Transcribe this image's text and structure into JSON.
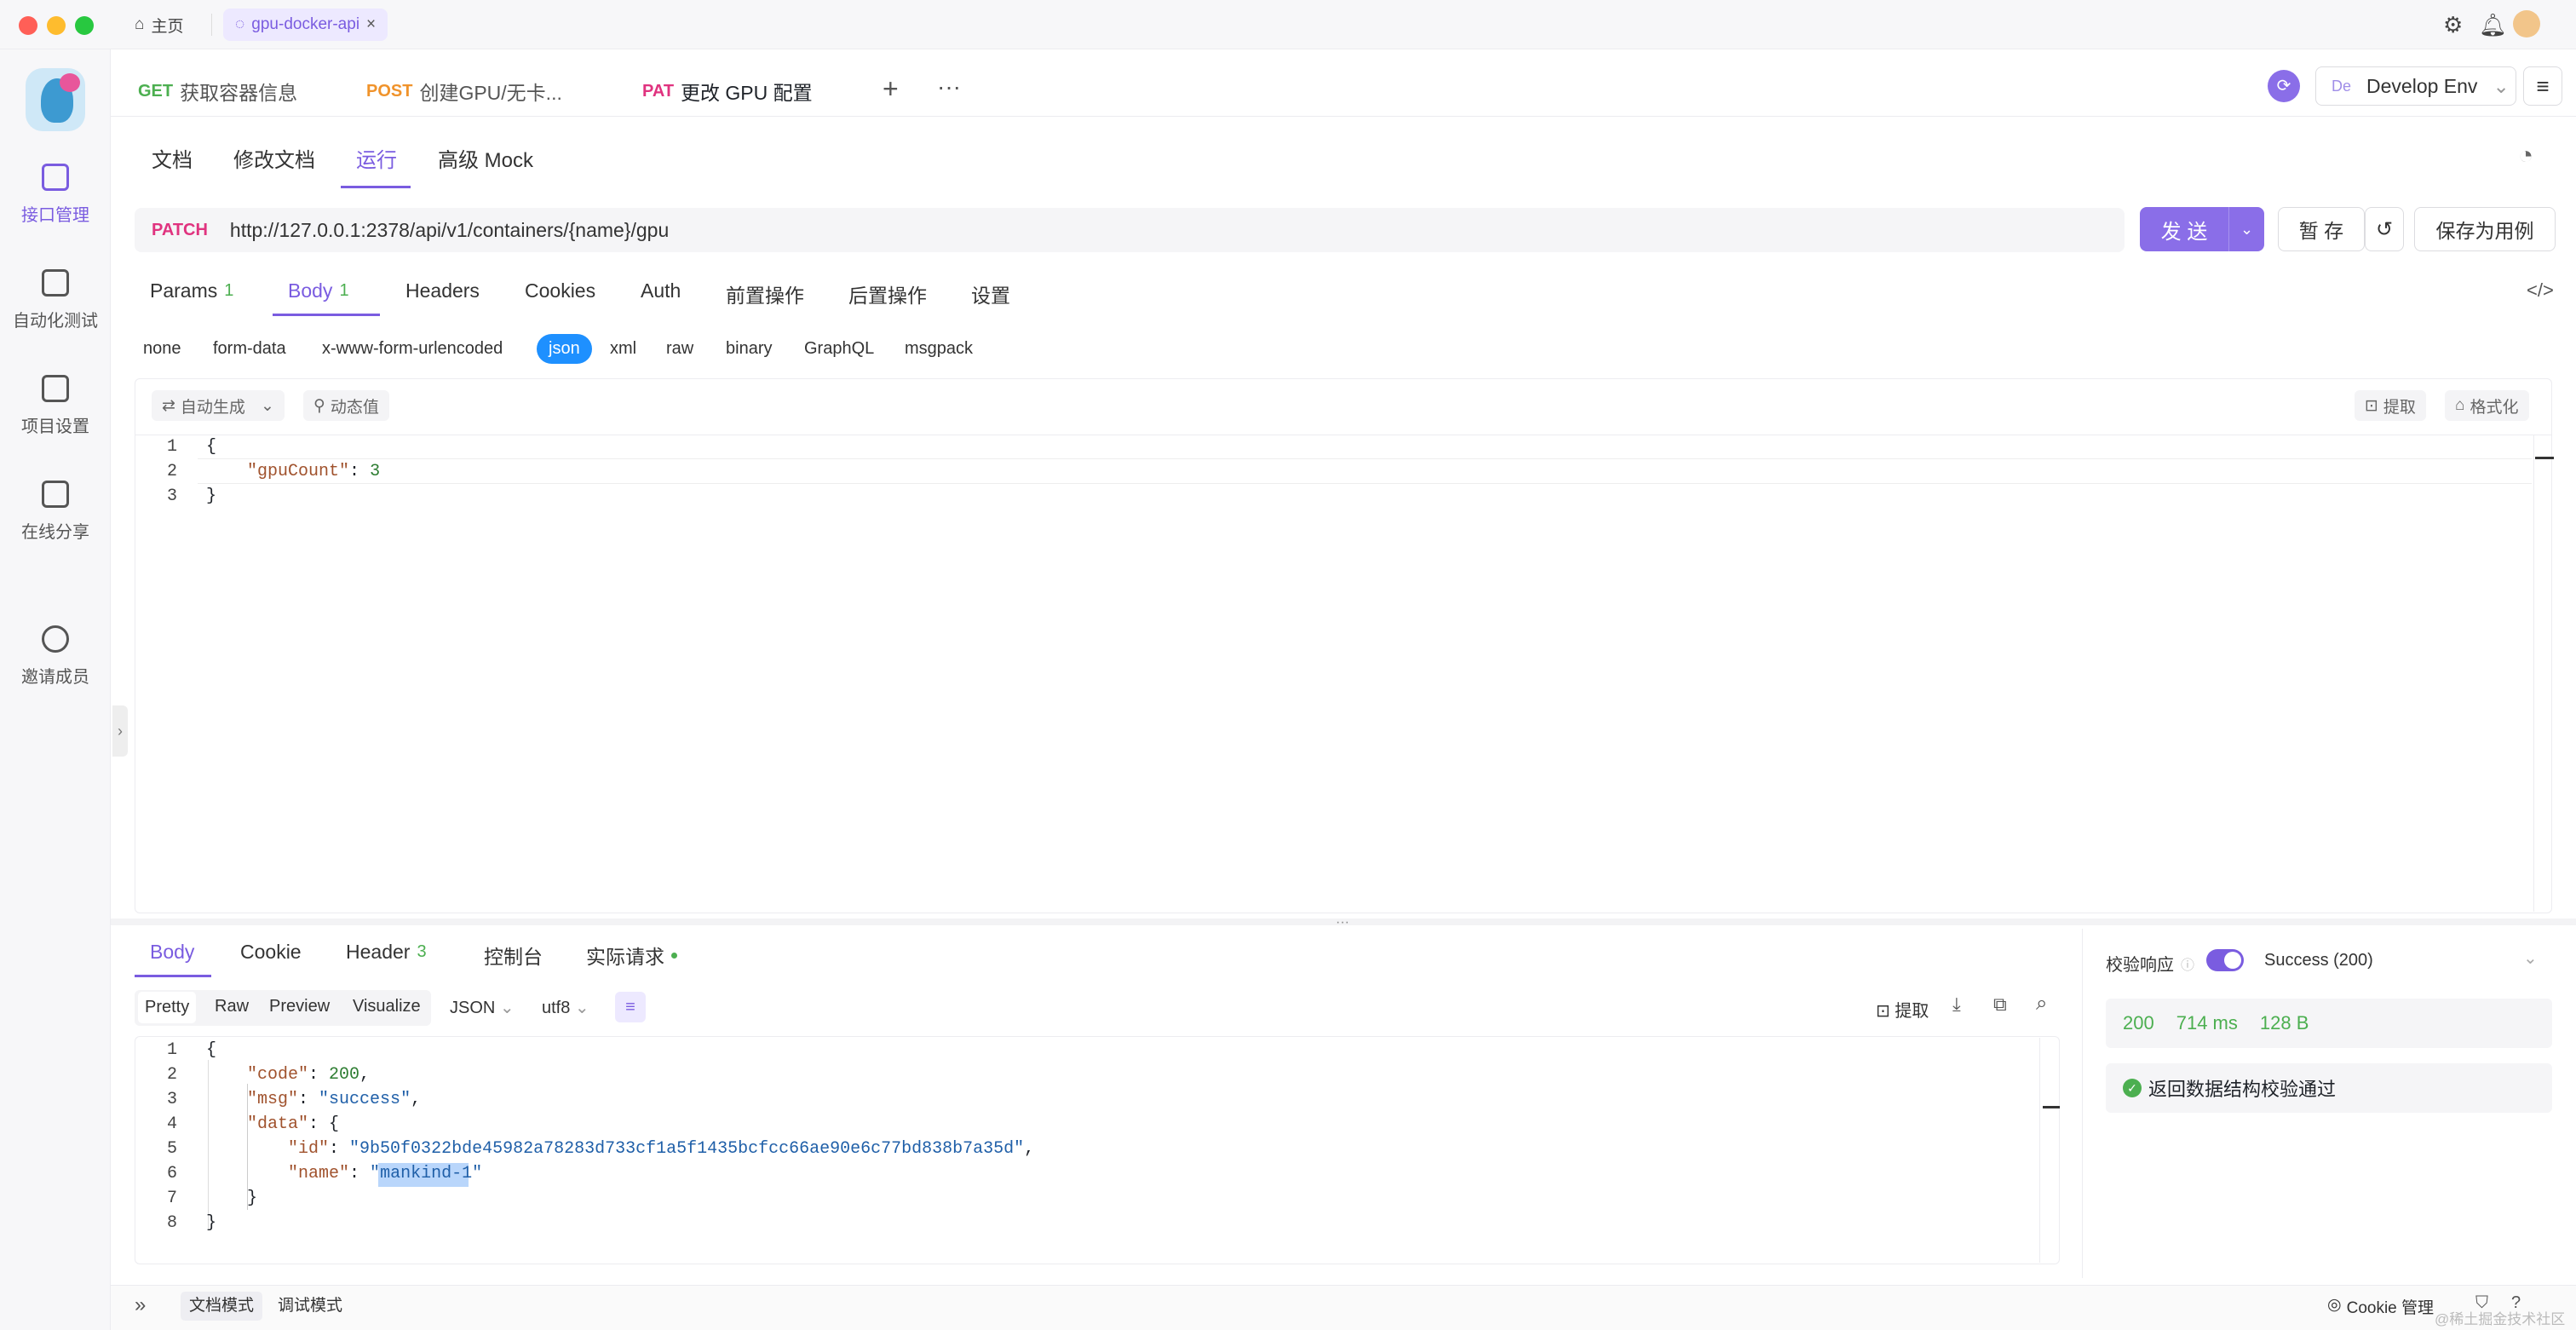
{
  "titlebar": {
    "home_label": "主页",
    "project_tab": "gpu-docker-api"
  },
  "sidebar": {
    "items": [
      {
        "label": "接口管理",
        "icon": "api-icon",
        "active": true
      },
      {
        "label": "自动化测试",
        "icon": "test-icon",
        "active": false
      },
      {
        "label": "项目设置",
        "icon": "settings-icon",
        "active": false
      },
      {
        "label": "在线分享",
        "icon": "share-icon",
        "active": false
      },
      {
        "label": "邀请成员",
        "icon": "invite-icon",
        "active": false
      }
    ]
  },
  "request_tabs": [
    {
      "method": "GET",
      "method_color": "#4caf50",
      "label": "获取容器信息"
    },
    {
      "method": "POST",
      "method_color": "#f0932b",
      "label": "创建GPU/无卡..."
    },
    {
      "method": "PAT",
      "method_color": "#e0337f",
      "label": "更改 GPU 配置"
    }
  ],
  "env": {
    "badge": "De",
    "label": "Develop Env"
  },
  "subtabs": [
    "文档",
    "修改文档",
    "运行",
    "高级 Mock"
  ],
  "url": {
    "method": "PATCH",
    "value": "http://127.0.0.1:2378/api/v1/containers/{name}/gpu",
    "send": "发 送",
    "save_temp": "暂 存",
    "save_case": "保存为用例"
  },
  "param_tabs": [
    {
      "label": "Params",
      "count": "1"
    },
    {
      "label": "Body",
      "count": "1"
    },
    {
      "label": "Headers",
      "count": ""
    },
    {
      "label": "Cookies",
      "count": ""
    },
    {
      "label": "Auth",
      "count": ""
    },
    {
      "label": "前置操作",
      "count": ""
    },
    {
      "label": "后置操作",
      "count": ""
    },
    {
      "label": "设置",
      "count": ""
    }
  ],
  "body_types": [
    "none",
    "form-data",
    "x-www-form-urlencoded",
    "json",
    "xml",
    "raw",
    "binary",
    "GraphQL",
    "msgpack"
  ],
  "editor_tools": {
    "auto": "自动生成",
    "dynamic": "动态值",
    "extract": "提取",
    "format": "格式化"
  },
  "request_body": {
    "lines": [
      "1",
      "2",
      "3"
    ],
    "open": "{",
    "key": "\"gpuCount\"",
    "colon": ": ",
    "value": "3",
    "close": "}"
  },
  "response_tabs": [
    {
      "label": "Body",
      "count": ""
    },
    {
      "label": "Cookie",
      "count": ""
    },
    {
      "label": "Header",
      "count": "3"
    },
    {
      "label": "控制台",
      "count": ""
    },
    {
      "label": "实际请求",
      "count": ""
    }
  ],
  "response_formats": [
    "Pretty",
    "Raw",
    "Preview",
    "Visualize",
    "JSON",
    "utf8"
  ],
  "response_tools": {
    "extract": "提取"
  },
  "response_body": {
    "lines": [
      "1",
      "2",
      "3",
      "4",
      "5",
      "6",
      "7",
      "8"
    ],
    "l1": "{",
    "code_key": "\"code\"",
    "code_val": "200",
    "msg_key": "\"msg\"",
    "msg_val": "\"success\"",
    "data_key": "\"data\"",
    "id_key": "\"id\"",
    "id_val": "\"9b50f0322bde45982a78283d733cf1a5f1435bcfcc66ae90e6c77bd838b7a35d\"",
    "name_key": "\"name\"",
    "name_q1": "\"",
    "name_sel": "mankind-1",
    "name_q2": "\"",
    "l7": "}",
    "l8": "}"
  },
  "validation": {
    "label": "校验响应",
    "result": "Success (200)",
    "status": "200",
    "time": "714 ms",
    "size": "128 B",
    "message": "返回数据结构校验通过"
  },
  "bottom": {
    "doc_mode": "文档模式",
    "debug_mode": "调试模式",
    "cookie": "Cookie 管理",
    "watermark": "@稀土掘金技术社区"
  },
  "colors": {
    "accent": "#7a5ce0",
    "success": "#4caf50",
    "json_active": "#1e90ff"
  }
}
